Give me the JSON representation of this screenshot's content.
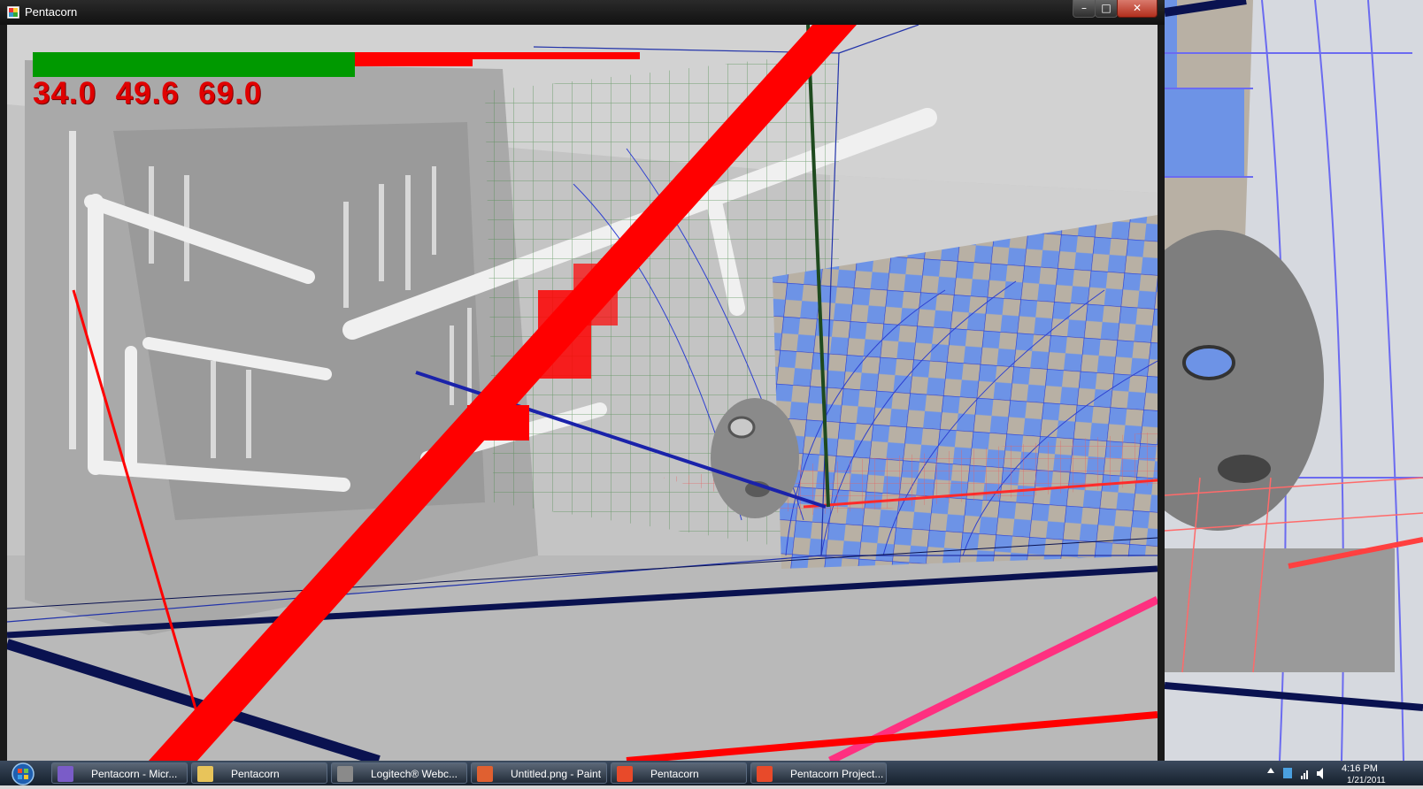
{
  "window": {
    "title": "Pentacorn",
    "minimize_glyph": "–",
    "maximize_glyph": "□",
    "close_glyph": "✕"
  },
  "hud": {
    "values_text": "34.0  49.6  69.0",
    "bars": [
      {
        "name": "green-bar",
        "color": "#009900",
        "fraction": 0.52
      },
      {
        "name": "red-bar-1",
        "color": "#ff0000",
        "fraction": 0.71
      },
      {
        "name": "red-bar-2",
        "color": "#ff0000",
        "fraction": 0.98
      }
    ]
  },
  "taskbar": {
    "items": [
      {
        "label": "Pentacorn - Micr...",
        "icon": "visual-studio-icon"
      },
      {
        "label": "Pentacorn",
        "icon": "folder-icon"
      },
      {
        "label": "Logitech® Webc...",
        "icon": "webcam-icon"
      },
      {
        "label": "Untitled.png - Paint",
        "icon": "paint-icon"
      },
      {
        "label": "Pentacorn",
        "icon": "app-window-icon"
      },
      {
        "label": "Pentacorn Project...",
        "icon": "app-window-icon"
      }
    ],
    "clock_time": "4:16 PM",
    "clock_date": "1/21/2011"
  },
  "colors": {
    "accent_red": "#ff0000",
    "grid_blue": "#3b5bdb",
    "checker_blue": "#6d93e6",
    "checker_tan": "#b8b0a4",
    "grid_green": "#4a8a4a",
    "line_navy": "#0a1250",
    "line_pink": "#ff3080"
  }
}
